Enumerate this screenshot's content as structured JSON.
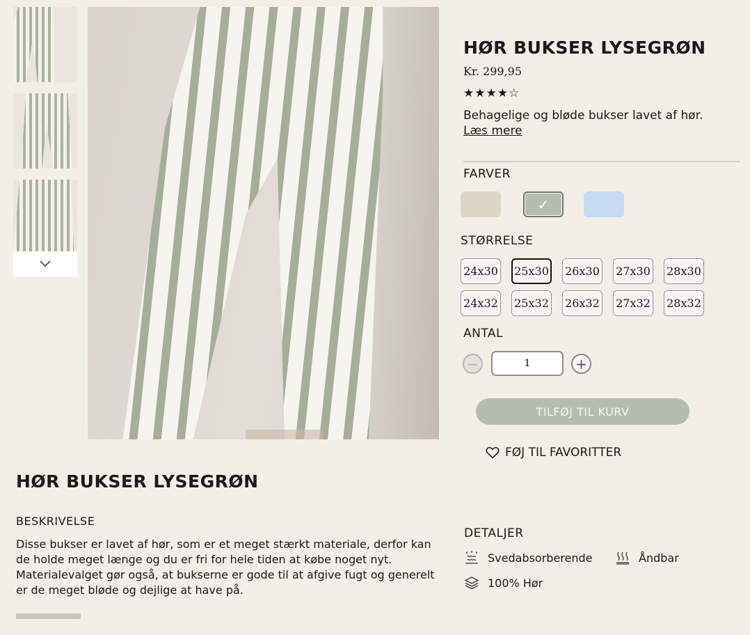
{
  "product": {
    "title": "HØR BUKSER LYSEGRØN",
    "price": "Kr. 299,95",
    "rating_stars": "★★★★☆",
    "rating_value": 4,
    "rating_max": 5,
    "short_description": "Behagelige og bløde bukser lavet af hør.",
    "read_more": "Læs mere"
  },
  "colors": {
    "label": "FARVER",
    "swatches": [
      "#ddd6c8",
      "#b5bdaf",
      "#c7dbf2"
    ],
    "selected_index": 1,
    "check": "✓"
  },
  "sizes": {
    "label": "STØRRELSE",
    "options": [
      "24x30",
      "25x30",
      "26x30",
      "27x30",
      "28x30",
      "24x32",
      "25x32",
      "26x32",
      "27x32",
      "28x32"
    ],
    "selected": "25x30"
  },
  "quantity": {
    "label": "ANTAL",
    "value": "1",
    "minus": "−",
    "plus": "+"
  },
  "actions": {
    "add_to_cart": "TILFØJ TIL KURV",
    "add_to_favorites": "FØJ TIL FAVORITTER"
  },
  "description": {
    "title": "HØR BUKSER LYSEGRØN",
    "label": "BESKRIVELSE",
    "text": "Disse bukser er lavet af hør, som er et meget stærkt materiale, derfor kan de holde meget længe og du er fri for hele tiden at købe noget nyt. Materialevalget gør også, at bukserne er gode til at afgive fugt og generelt er de meget bløde og dejlige at have på."
  },
  "details": {
    "label": "DETALJER",
    "items": [
      "Svedabsorberende",
      "Åndbar",
      "100% Hør"
    ]
  },
  "icons": {
    "thumb_next": "chevron-down-icon",
    "favorite": "heart-icon",
    "sweat": "sweat-drops-icon",
    "breathable": "heat-waves-icon",
    "material": "layers-icon"
  },
  "theme": {
    "background": "#f2efe9",
    "accent_sage": "#b5bdaf",
    "text": "#1a1a1a"
  }
}
